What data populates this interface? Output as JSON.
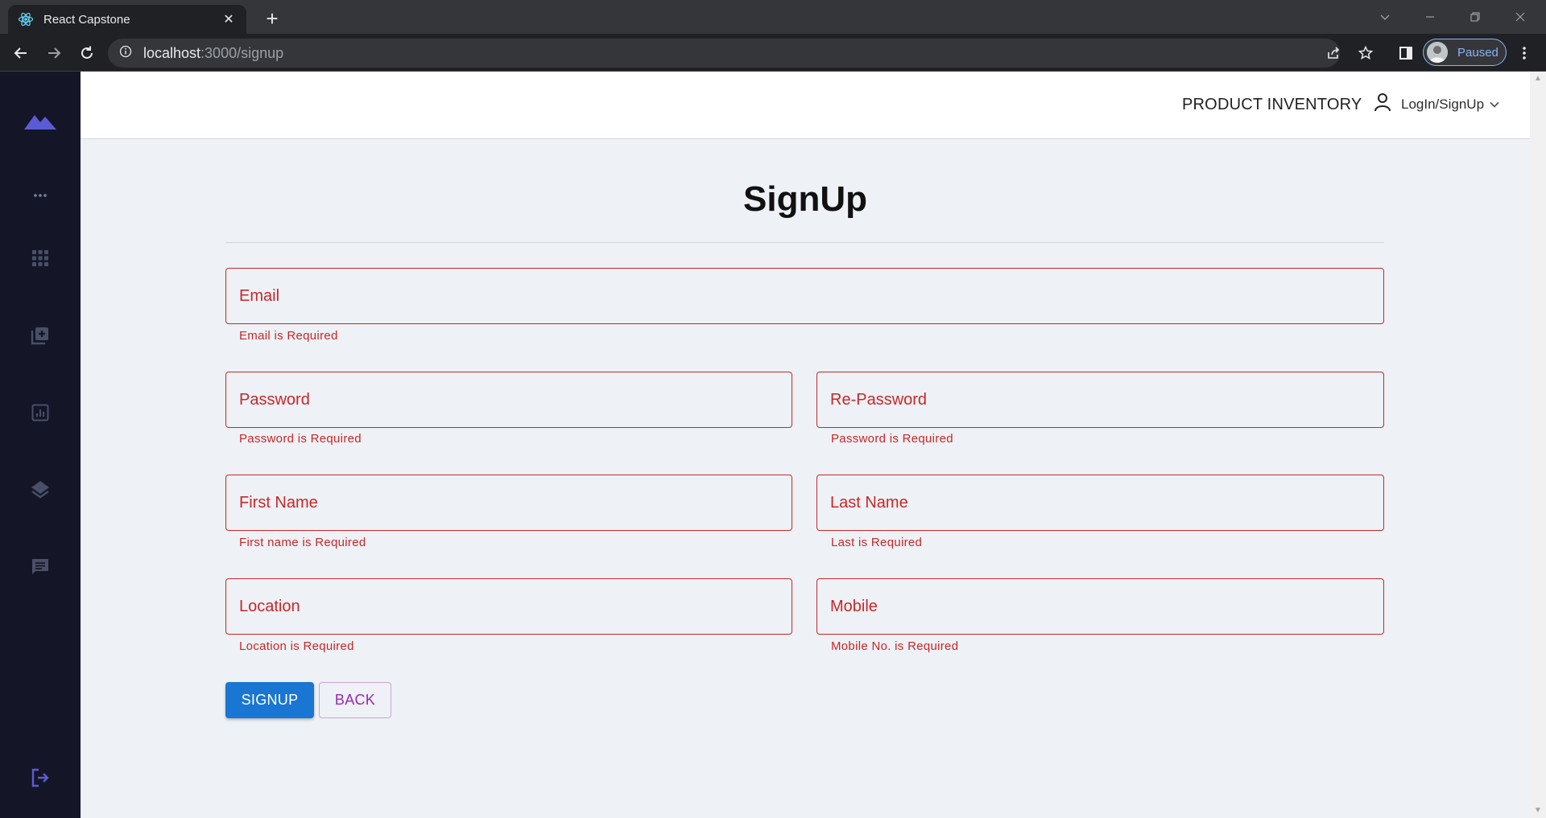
{
  "browser": {
    "tab_title": "React Capstone",
    "tab_close": "✕",
    "new_tab": "+",
    "url_host": "localhost",
    "url_rest": ":3000/signup",
    "profile_label": "Paused"
  },
  "sidebar": {
    "items": [
      {
        "icon": "logo-mountain-icon"
      },
      {
        "icon": "more-dots-icon"
      },
      {
        "icon": "apps-grid-icon"
      },
      {
        "icon": "add-library-icon"
      },
      {
        "icon": "analytics-icon"
      },
      {
        "icon": "layers-icon"
      },
      {
        "icon": "chat-icon"
      },
      {
        "icon": "logout-icon"
      }
    ],
    "accent": "#5b5bd6"
  },
  "header": {
    "brand": "PRODUCT INVENTORY",
    "user_menu_label": "LogIn/SignUp"
  },
  "form": {
    "title": "SignUp",
    "fields": {
      "email": {
        "placeholder": "Email",
        "error": "Email is Required"
      },
      "password": {
        "placeholder": "Password",
        "error": "Password is Required"
      },
      "repassword": {
        "placeholder": "Re-Password",
        "error": "Password is Required"
      },
      "first_name": {
        "placeholder": "First Name",
        "error": "First name is Required"
      },
      "last_name": {
        "placeholder": "Last Name",
        "error": "Last is Required"
      },
      "location": {
        "placeholder": "Location",
        "error": "Location is Required"
      },
      "mobile": {
        "placeholder": "Mobile",
        "error": "Mobile No. is Required"
      }
    },
    "signup_label": "SIGNUP",
    "back_label": "BACK",
    "error_color": "#c62828",
    "primary_color": "#1976d2",
    "secondary_color": "#9c27b0"
  }
}
